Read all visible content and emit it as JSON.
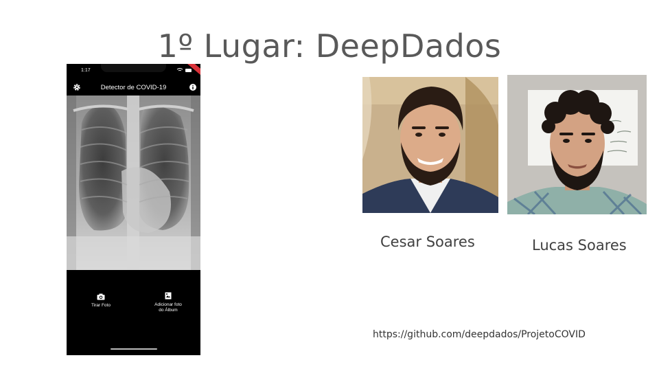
{
  "slide": {
    "title": "1º Lugar: DeepDados"
  },
  "phone": {
    "status_time": "1:17",
    "app_title": "Detector de COVID-19",
    "settings_icon": "gear-icon",
    "info_icon": "info-icon",
    "actions": [
      {
        "label": "Tirar Foto",
        "icon": "camera-icon"
      },
      {
        "label_line1": "Adicionar foto",
        "label_line2": "do Álbum",
        "icon": "gallery-icon"
      }
    ]
  },
  "people": [
    {
      "name": "Cesar Soares"
    },
    {
      "name": "Lucas Soares"
    }
  ],
  "link": {
    "text": "https://github.com/deepdados/ProjetoCOVID"
  },
  "colors": {
    "title": "#595959",
    "text": "#404040",
    "phone_bg": "#000000",
    "accent_ribbon": "#d9333a"
  }
}
